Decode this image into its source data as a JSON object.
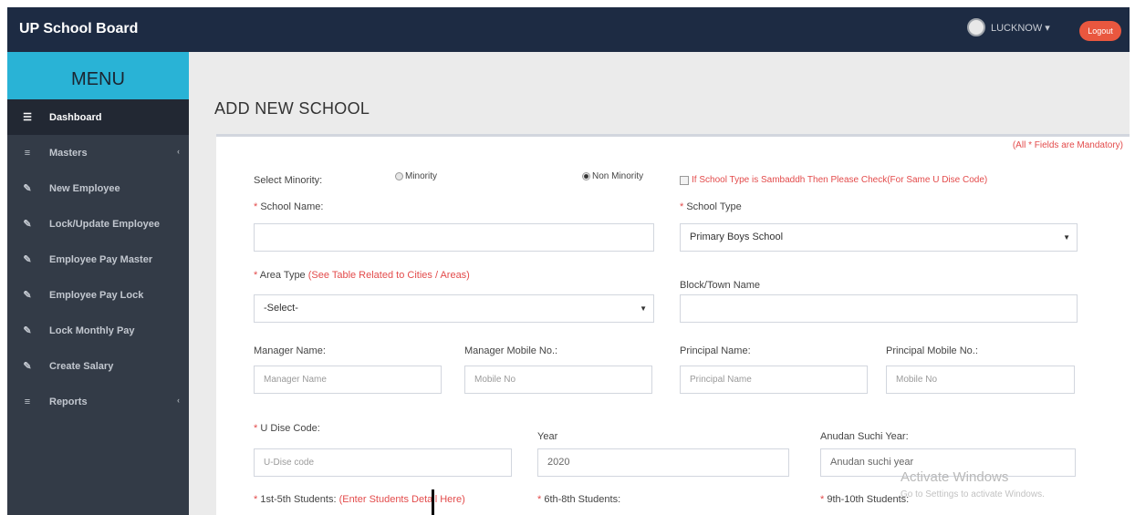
{
  "app": {
    "brand": "UP School Board"
  },
  "user": {
    "name": "LUCKNOW ▾",
    "logout_label": "Logout"
  },
  "menu": {
    "header": "MENU",
    "items": [
      {
        "icon": "☰",
        "icon_name": "dashboard-icon",
        "label": "Dashboard",
        "active": true
      },
      {
        "icon": "≡",
        "icon_name": "list-icon",
        "label": "Masters",
        "caret": "‹"
      },
      {
        "icon": "✎",
        "icon_name": "pencil-icon",
        "label": "New Employee"
      },
      {
        "icon": "✎",
        "icon_name": "pencil-icon",
        "label": "Lock/Update Employee"
      },
      {
        "icon": "✎",
        "icon_name": "pencil-icon",
        "label": "Employee Pay Master"
      },
      {
        "icon": "✎",
        "icon_name": "pencil-icon",
        "label": "Employee Pay Lock"
      },
      {
        "icon": "✎",
        "icon_name": "pencil-icon",
        "label": "Lock Monthly Pay"
      },
      {
        "icon": "✎",
        "icon_name": "pencil-icon",
        "label": "Create Salary"
      },
      {
        "icon": "≡",
        "icon_name": "list-icon",
        "label": "Reports",
        "caret": "‹"
      }
    ]
  },
  "page": {
    "title": "ADD NEW SCHOOL",
    "required_note": "(All * Fields are Mandatory)"
  },
  "form": {
    "select_minority_label": "Select Minority:",
    "minority_option": "Minority",
    "non_minority_option": "Non Minority",
    "sambaddh_check": "If School Type is Sambaddh Then Please Check(For Same U Dise Code)",
    "school_name": {
      "star": "* ",
      "label": "School Name:",
      "value": ""
    },
    "school_type": {
      "star": "* ",
      "label": "School Type",
      "selected": "Primary Boys School"
    },
    "area_type": {
      "star": "* ",
      "label": "Area Type ",
      "hint": "(See Table Related to Cities / Areas)",
      "selected": "-Select-"
    },
    "block_town": {
      "label": "Block/Town Name",
      "value": ""
    },
    "manager_name": {
      "label": "Manager Name:",
      "placeholder": "Manager Name"
    },
    "manager_mobile": {
      "label": "Manager Mobile No.:",
      "placeholder": "Mobile No"
    },
    "principal_name": {
      "label": "Principal Name:",
      "placeholder": "Principal Name"
    },
    "principal_mobile": {
      "label": "Principal Mobile No.:",
      "placeholder": "Mobile No"
    },
    "udise_code": {
      "star": "* ",
      "label": "U Dise Code:",
      "placeholder": "U-Dise code"
    },
    "year": {
      "label": "Year",
      "value": "2020"
    },
    "anudan_year": {
      "label": "Anudan Suchi Year:",
      "value": "Anudan suchi year"
    },
    "students_1_5": {
      "star": "* ",
      "label": "1st-5th Students: ",
      "hint": "(Enter Students Detail Here)"
    },
    "students_6_8": {
      "star": "* ",
      "label": "6th-8th Students:"
    },
    "students_9_10": {
      "star": "* ",
      "label": "9th-10th Students:"
    }
  },
  "os": {
    "activate_title": "Activate Windows",
    "activate_sub": "Go to Settings to activate Windows."
  }
}
